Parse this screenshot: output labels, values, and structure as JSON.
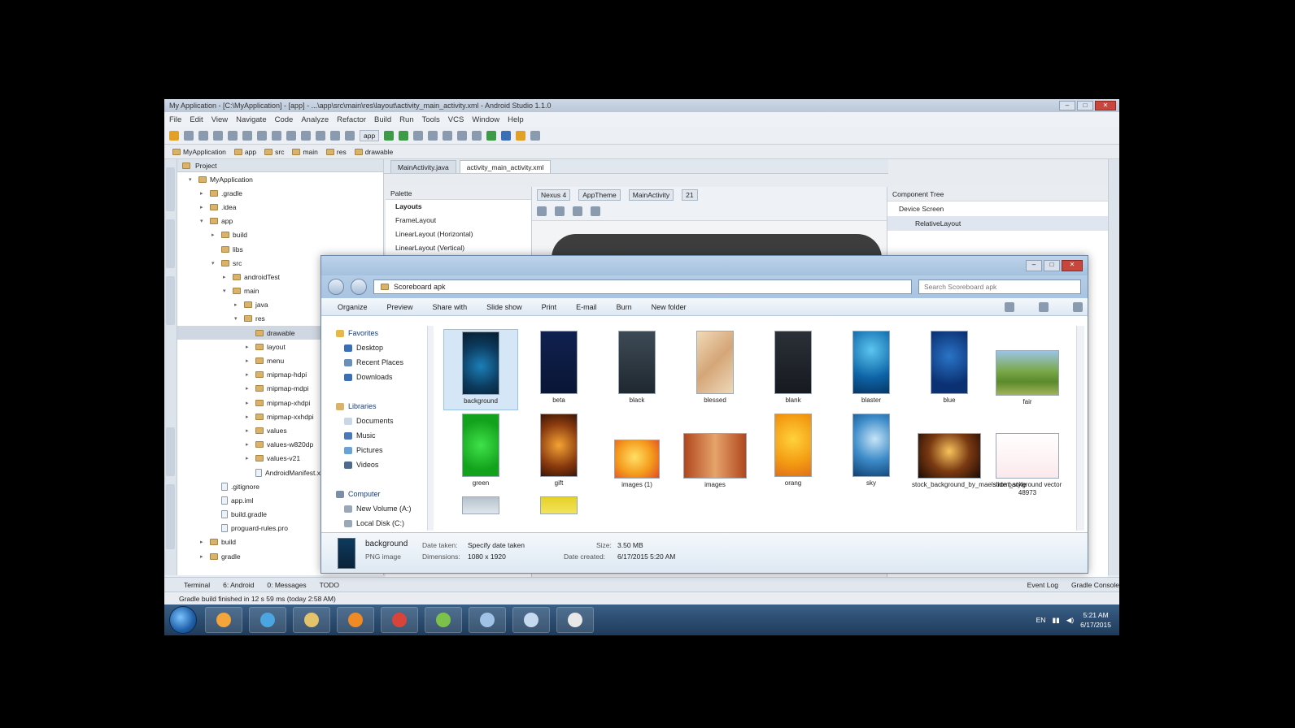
{
  "ide": {
    "window_title": "My Application - [C:\\MyApplication] - [app] - ...\\app\\src\\main\\res\\layout\\activity_main_activity.xml - Android Studio 1.1.0",
    "menu": [
      "File",
      "Edit",
      "View",
      "Navigate",
      "Code",
      "Analyze",
      "Refactor",
      "Build",
      "Run",
      "Tools",
      "VCS",
      "Window",
      "Help"
    ],
    "toolbar_config": "app",
    "nav_crumbs": [
      "MyApplication",
      "app",
      "src",
      "main",
      "res",
      "drawable"
    ],
    "project_panel_title": "Project",
    "project_tree": [
      {
        "label": "MyApplication",
        "indent": 1,
        "icon": "folder",
        "twisty": "▾"
      },
      {
        "label": ".gradle",
        "indent": 2,
        "icon": "folder",
        "twisty": "▸"
      },
      {
        "label": ".idea",
        "indent": 2,
        "icon": "folder",
        "twisty": "▸"
      },
      {
        "label": "app",
        "indent": 2,
        "icon": "folder",
        "twisty": "▾"
      },
      {
        "label": "build",
        "indent": 3,
        "icon": "folder",
        "twisty": "▸"
      },
      {
        "label": "libs",
        "indent": 3,
        "icon": "folder",
        "twisty": ""
      },
      {
        "label": "src",
        "indent": 3,
        "icon": "folder",
        "twisty": "▾"
      },
      {
        "label": "androidTest",
        "indent": 4,
        "icon": "folder",
        "twisty": "▸"
      },
      {
        "label": "main",
        "indent": 4,
        "icon": "folder",
        "twisty": "▾"
      },
      {
        "label": "java",
        "indent": 5,
        "icon": "folder",
        "twisty": "▸"
      },
      {
        "label": "res",
        "indent": 5,
        "icon": "folder",
        "twisty": "▾"
      },
      {
        "label": "drawable",
        "indent": 6,
        "icon": "folder",
        "twisty": "",
        "selected": true
      },
      {
        "label": "layout",
        "indent": 6,
        "icon": "folder",
        "twisty": "▸"
      },
      {
        "label": "menu",
        "indent": 6,
        "icon": "folder",
        "twisty": "▸"
      },
      {
        "label": "mipmap-hdpi",
        "indent": 6,
        "icon": "folder",
        "twisty": "▸"
      },
      {
        "label": "mipmap-mdpi",
        "indent": 6,
        "icon": "folder",
        "twisty": "▸"
      },
      {
        "label": "mipmap-xhdpi",
        "indent": 6,
        "icon": "folder",
        "twisty": "▸"
      },
      {
        "label": "mipmap-xxhdpi",
        "indent": 6,
        "icon": "folder",
        "twisty": "▸"
      },
      {
        "label": "values",
        "indent": 6,
        "icon": "folder",
        "twisty": "▸"
      },
      {
        "label": "values-w820dp",
        "indent": 6,
        "icon": "folder",
        "twisty": "▸"
      },
      {
        "label": "values-v21",
        "indent": 6,
        "icon": "folder",
        "twisty": "▸"
      },
      {
        "label": "AndroidManifest.xml",
        "indent": 6,
        "icon": "file",
        "twisty": ""
      },
      {
        "label": ".gitignore",
        "indent": 3,
        "icon": "file",
        "twisty": ""
      },
      {
        "label": "app.iml",
        "indent": 3,
        "icon": "file",
        "twisty": ""
      },
      {
        "label": "build.gradle",
        "indent": 3,
        "icon": "file",
        "twisty": ""
      },
      {
        "label": "proguard-rules.pro",
        "indent": 3,
        "icon": "file",
        "twisty": ""
      },
      {
        "label": "build",
        "indent": 2,
        "icon": "folder",
        "twisty": "▸"
      },
      {
        "label": "gradle",
        "indent": 2,
        "icon": "folder",
        "twisty": "▸"
      }
    ],
    "editor_tabs": [
      "MainActivity.java",
      "activity_main_activity.xml"
    ],
    "palette_title": "Palette",
    "palette_items": [
      "Layouts",
      "FrameLayout",
      "LinearLayout (Horizontal)",
      "LinearLayout (Vertical)"
    ],
    "design_bar": [
      "Nexus 4",
      "AppTheme",
      "MainActivity",
      "21"
    ],
    "component_tree_title": "Component Tree",
    "component_tree": [
      "Device Screen",
      "RelativeLayout"
    ],
    "bottom_tabs_left": [
      "Terminal",
      "6: Android",
      "0: Messages",
      "TODO"
    ],
    "bottom_tabs_right": [
      "Event Log",
      "Gradle Console"
    ],
    "status_text": "Gradle build finished in 12 s 59 ms (today 2:58 AM)"
  },
  "explorer": {
    "address": "Scoreboard apk",
    "search_placeholder": "Search Scoreboard apk",
    "commands": [
      "Organize",
      "Preview",
      "Share with",
      "Slide show",
      "Print",
      "E-mail",
      "Burn",
      "New folder"
    ],
    "nav": [
      {
        "label": "Favorites",
        "type": "header",
        "color": "#e6b84a"
      },
      {
        "label": "Desktop",
        "type": "item",
        "color": "#3a6fb5"
      },
      {
        "label": "Recent Places",
        "type": "item",
        "color": "#6a8fb8"
      },
      {
        "label": "Downloads",
        "type": "item",
        "color": "#3a6fb5"
      },
      {
        "label": "",
        "type": "gap",
        "color": ""
      },
      {
        "label": "Libraries",
        "type": "header",
        "color": "#d9b36b"
      },
      {
        "label": "Documents",
        "type": "item",
        "color": "#c9d6e6"
      },
      {
        "label": "Music",
        "type": "item",
        "color": "#4a78b8"
      },
      {
        "label": "Pictures",
        "type": "item",
        "color": "#6aa2d6"
      },
      {
        "label": "Videos",
        "type": "item",
        "color": "#506a8c"
      },
      {
        "label": "",
        "type": "gap",
        "color": ""
      },
      {
        "label": "Computer",
        "type": "header",
        "color": "#7c8ea5"
      },
      {
        "label": "New Volume (A:)",
        "type": "item",
        "color": "#9aa7b6"
      },
      {
        "label": "Local Disk (C:)",
        "type": "item",
        "color": "#9aa7b6"
      }
    ],
    "files": [
      {
        "name": "background",
        "row": 0,
        "col": 0,
        "shape": "tall",
        "grad": "radial-gradient(circle at 50% 55%, #1b7fb8, #0c3b5e 55%, #071c2e)",
        "selected": true
      },
      {
        "name": "beta",
        "row": 0,
        "col": 1,
        "shape": "tall",
        "grad": "linear-gradient(#10214f, #0a1535)",
        "selected": false
      },
      {
        "name": "black",
        "row": 0,
        "col": 2,
        "shape": "tall",
        "grad": "linear-gradient(#3d4a55, #1f2830)",
        "selected": false
      },
      {
        "name": "blessed",
        "row": 0,
        "col": 3,
        "shape": "tall",
        "grad": "linear-gradient(135deg, #f1d9b8, #d4a677, #efd8b9)",
        "selected": false
      },
      {
        "name": "blank",
        "row": 0,
        "col": 4,
        "shape": "tall",
        "grad": "linear-gradient(#2b3038, #161a1f)",
        "selected": false
      },
      {
        "name": "blaster",
        "row": 0,
        "col": 5,
        "shape": "tall",
        "grad": "radial-gradient(circle at 50% 30%, #5bc6ef, #0d63a6 60%, #073765)",
        "selected": false
      },
      {
        "name": "blue",
        "row": 0,
        "col": 6,
        "shape": "tall",
        "grad": "radial-gradient(circle at 50% 40%, #2a74c7, #0b3173 70%)",
        "selected": false
      },
      {
        "name": "fair",
        "row": 0,
        "col": 7,
        "shape": "wide",
        "grad": "linear-gradient(#9cc4e6 0%, #7aa94a 45%, #5a8a2a 70%, #a3b35a 100%)",
        "selected": false
      },
      {
        "name": "green",
        "row": 1,
        "col": 0,
        "shape": "tall",
        "grad": "radial-gradient(circle at 50% 50%, #3fe14a, #13a21c 70%)",
        "selected": false
      },
      {
        "name": "gift",
        "row": 1,
        "col": 1,
        "shape": "tall",
        "grad": "radial-gradient(circle at 50% 50%, #f4a234, #8a3b0e 60%, #3b1505)",
        "selected": false
      },
      {
        "name": "images (1)",
        "row": 1,
        "col": 2,
        "shape": "small",
        "grad": "radial-gradient(circle at 45% 45%, #ffe066, #f49a1c 55%, #e04a2a)",
        "selected": false
      },
      {
        "name": "images",
        "row": 1,
        "col": 3,
        "shape": "wide",
        "grad": "linear-gradient(90deg, #b0471e, #e6a36a 50%, #b0471e)",
        "selected": false
      },
      {
        "name": "orang",
        "row": 1,
        "col": 4,
        "shape": "tall",
        "grad": "radial-gradient(circle at 50% 40%, #ffd23a, #f39a12 60%, #e0701a)",
        "selected": false
      },
      {
        "name": "sky",
        "row": 1,
        "col": 5,
        "shape": "tall",
        "grad": "radial-gradient(circle at 60% 40%, #c6e4f7, #3d8cc9 50%, #0f3f72)",
        "selected": false
      },
      {
        "name": "stock_background_by_maelstrom_style",
        "row": 1,
        "col": 6,
        "shape": "wide",
        "grad": "radial-gradient(circle at 50% 40%, #f7c35c, #7a3a12 50%, #1d0a03)",
        "selected": false
      },
      {
        "name": "slide background vector 48973",
        "row": 1,
        "col": 7,
        "shape": "wide",
        "grad": "linear-gradient(#ffffff, #fbe9ec)",
        "selected": false
      },
      {
        "name": "",
        "row": 2,
        "col": 0,
        "shape": "partial",
        "grad": "linear-gradient(#b6c2cc, #dfe6ec)",
        "selected": false
      },
      {
        "name": "",
        "row": 2,
        "col": 1,
        "shape": "partial",
        "grad": "linear-gradient(#e5d22a, #f3e35a)",
        "selected": false
      }
    ],
    "details": {
      "name": "background",
      "type": "PNG image",
      "date_taken_label": "Date taken:",
      "date_taken": "Specify date taken",
      "dimensions_label": "Dimensions:",
      "dimensions": "1080 x 1920",
      "size_label": "Size:",
      "size": "3.50 MB",
      "date_created_label": "Date created:",
      "date_created": "6/17/2015 5:20 AM"
    }
  },
  "taskbar": {
    "apps": [
      {
        "name": "media-player",
        "color": "#f3a43a"
      },
      {
        "name": "internet-explorer",
        "color": "#4aa5e0"
      },
      {
        "name": "file-explorer",
        "color": "#e3c46a"
      },
      {
        "name": "vlc",
        "color": "#f08a24"
      },
      {
        "name": "chrome",
        "color": "#d9443a"
      },
      {
        "name": "android-studio",
        "color": "#7cc24a"
      },
      {
        "name": "downloads",
        "color": "#9fc2e6"
      },
      {
        "name": "document",
        "color": "#c5d9ef"
      },
      {
        "name": "usb-device",
        "color": "#e8e8e8"
      }
    ],
    "lang": "EN",
    "time": "5:21 AM",
    "date": "6/17/2015"
  }
}
